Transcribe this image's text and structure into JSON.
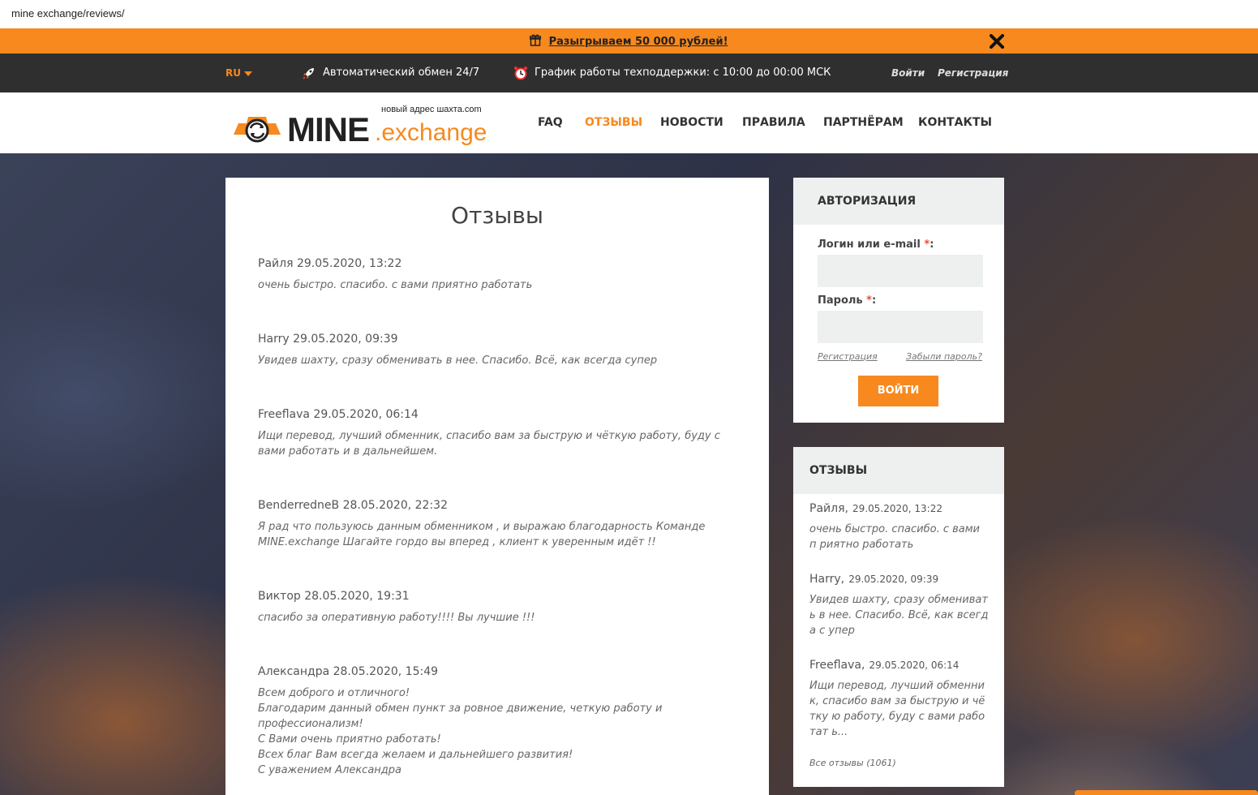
{
  "browser": {
    "url": "mine exchange/reviews/"
  },
  "promo": {
    "text": "Разыгрываем 50 000 рублей!",
    "icon": "gift-icon",
    "close_icon": "close-icon"
  },
  "topbar": {
    "lang": "RU",
    "auto_exchange": "Автоматический обмен 24/7",
    "schedule": "График работы техподдержки: с 10:00 до 00:00 МСК",
    "login": "Войти",
    "register": "Регистрация"
  },
  "logo": {
    "mine": "MINE",
    "exchange": ".exchange",
    "tagline": "новый адрес шахта.com"
  },
  "nav": [
    {
      "label": "FAQ",
      "active": false
    },
    {
      "label": "ОТЗЫВЫ",
      "active": true
    },
    {
      "label": "НОВОСТИ",
      "active": false
    },
    {
      "label": "ПРАВИЛА",
      "active": false
    },
    {
      "label": "ПАРТНЁРАМ",
      "active": false
    },
    {
      "label": "КОНТАКТЫ",
      "active": false
    }
  ],
  "main": {
    "title": "Отзывы",
    "reviews": [
      {
        "meta": "Райля 29.05.2020, 13:22",
        "text": "очень быстро. спасибо. с вами приятно работать"
      },
      {
        "meta": "Harry 29.05.2020, 09:39",
        "text": "Увидев шахту, сразу обменивать в нее. Спасибо. Всё, как всегда супер"
      },
      {
        "meta": "Freeflava 29.05.2020, 06:14",
        "text": "Ищи перевод, лучший обменник, спасибо вам за быструю и чёткую работу, буду с вами работать и в дальнейшем."
      },
      {
        "meta": "BenderredneB 28.05.2020, 22:32",
        "text": "Я рад что пользуюсь данным обменником , и выражаю благодарность Команде MINE.exchange Шагайте гордо вы вперед , клиент к уверенным идёт !!"
      },
      {
        "meta": "Виктор 28.05.2020, 19:31",
        "text": "спасибо за оперативную работу!!!! Вы лучшие !!!"
      },
      {
        "meta": "Александра 28.05.2020, 15:49",
        "text": "Всем доброго и отличного!\nБлагодарим данный обмен пункт за ровное движение, четкую работу и профессионализм!\nС Вами очень приятно работать!\nВсех благ Вам всегда желаем и дальнейшего развития!\nС уважением Александра"
      }
    ]
  },
  "auth": {
    "title": "АВТОРИЗАЦИЯ",
    "login_label": "Логин или e-mail",
    "password_label": "Пароль",
    "required_mark": "*",
    "colon": ":",
    "login_value": "",
    "password_value": "",
    "register_link": "Регистрация",
    "forgot_link": "Забыли пароль?",
    "submit": "ВОЙТИ"
  },
  "sidebar_reviews": {
    "title": "ОТЗЫВЫ",
    "items": [
      {
        "name": "Райля,",
        "date": "29.05.2020, 13:22",
        "text": "очень быстро. спасибо. с вами п риятно работать"
      },
      {
        "name": "Harry,",
        "date": "29.05.2020, 09:39",
        "text": "Увидев шахту, сразу обмениват ь в нее. Спасибо. Всё, как всегда с упер"
      },
      {
        "name": "Freeflava,",
        "date": "29.05.2020, 06:14",
        "text": "Ищи перевод, лучший обменник, спасибо вам за быструю и чётку ю работу, буду с вами работат ь..."
      }
    ],
    "all_link": "Все отзывы (1061)"
  },
  "colors": {
    "accent": "#f7891e",
    "topbar": "#2f2f2f",
    "panel_header": "#eef0f0"
  }
}
